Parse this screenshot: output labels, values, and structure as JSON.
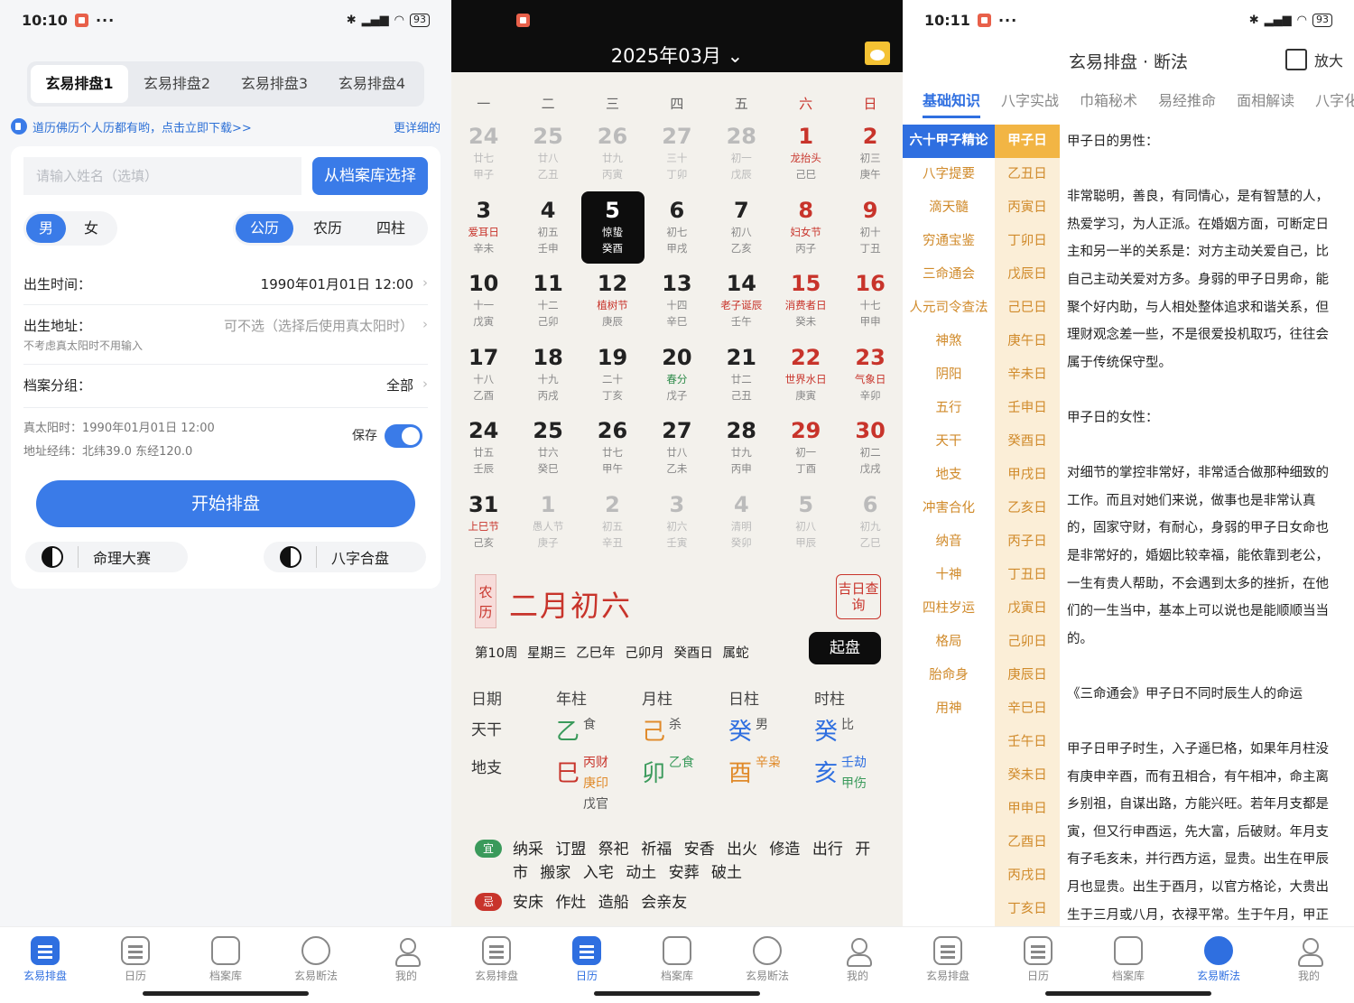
{
  "screen1": {
    "status": {
      "time": "10:10",
      "battery": "93"
    },
    "tabs": [
      "玄易排盘1",
      "玄易排盘2",
      "玄易排盘3",
      "玄易排盘4"
    ],
    "notice": {
      "text": "道历佛历个人历都有哟，点击立即下载>>",
      "more": "更详细的"
    },
    "name_placeholder": "请输入姓名（选填）",
    "archive_button": "从档案库选择",
    "gender": [
      "男",
      "女"
    ],
    "calendar_types": [
      "公历",
      "农历",
      "四柱"
    ],
    "birth_time": {
      "label": "出生时间：",
      "value": "1990年01月01日 12:00"
    },
    "birth_place": {
      "label": "出生地址：",
      "placeholder": "可不选（选择后使用真太阳时）",
      "hint": "不考虑真太阳时不用输入"
    },
    "group": {
      "label": "档案分组：",
      "value": "全部"
    },
    "solar_time": "真太阳时：1990年01月01日 12:00",
    "coords": "地址经纬：北纬39.0 东经120.0",
    "save_label": "保存",
    "start_button": "开始排盘",
    "contest_button": "命理大赛",
    "match_button": "八字合盘"
  },
  "nav": [
    "玄易排盘",
    "日历",
    "档案库",
    "玄易断法",
    "我的"
  ],
  "screen2": {
    "title": "2025年03月",
    "weekdays": [
      "一",
      "二",
      "三",
      "四",
      "五",
      "六",
      "日"
    ],
    "days": [
      {
        "d": "24",
        "l1": "廿七",
        "l2": "甲子",
        "t": "dim"
      },
      {
        "d": "25",
        "l1": "廿八",
        "l2": "乙丑",
        "t": "dim"
      },
      {
        "d": "26",
        "l1": "廿九",
        "l2": "丙寅",
        "t": "dim"
      },
      {
        "d": "27",
        "l1": "三十",
        "l2": "丁卯",
        "t": "dim"
      },
      {
        "d": "28",
        "l1": "初一",
        "l2": "戊辰",
        "t": "dim"
      },
      {
        "d": "1",
        "l1": "龙抬头",
        "l2": "己巳",
        "t": "red festred"
      },
      {
        "d": "2",
        "l1": "初三",
        "l2": "庚午",
        "t": "red"
      },
      {
        "d": "3",
        "l1": "爱耳日",
        "l2": "辛未",
        "t": "festred"
      },
      {
        "d": "4",
        "l1": "初五",
        "l2": "壬申",
        "t": ""
      },
      {
        "d": "5",
        "l1": "惊蛰",
        "l2": "癸酉",
        "t": "sel"
      },
      {
        "d": "6",
        "l1": "初七",
        "l2": "甲戌",
        "t": ""
      },
      {
        "d": "7",
        "l1": "初八",
        "l2": "乙亥",
        "t": ""
      },
      {
        "d": "8",
        "l1": "妇女节",
        "l2": "丙子",
        "t": "red festred"
      },
      {
        "d": "9",
        "l1": "初十",
        "l2": "丁丑",
        "t": "red"
      },
      {
        "d": "10",
        "l1": "十一",
        "l2": "戊寅",
        "t": ""
      },
      {
        "d": "11",
        "l1": "十二",
        "l2": "己卯",
        "t": ""
      },
      {
        "d": "12",
        "l1": "植树节",
        "l2": "庚辰",
        "t": "festred"
      },
      {
        "d": "13",
        "l1": "十四",
        "l2": "辛巳",
        "t": ""
      },
      {
        "d": "14",
        "l1": "老子诞辰",
        "l2": "壬午",
        "t": "festred"
      },
      {
        "d": "15",
        "l1": "消费者日",
        "l2": "癸未",
        "t": "red festred"
      },
      {
        "d": "16",
        "l1": "十七",
        "l2": "甲申",
        "t": "red"
      },
      {
        "d": "17",
        "l1": "十八",
        "l2": "乙酉",
        "t": ""
      },
      {
        "d": "18",
        "l1": "十九",
        "l2": "丙戌",
        "t": ""
      },
      {
        "d": "19",
        "l1": "二十",
        "l2": "丁亥",
        "t": ""
      },
      {
        "d": "20",
        "l1": "春分",
        "l2": "戊子",
        "t": "festgreen"
      },
      {
        "d": "21",
        "l1": "廿二",
        "l2": "己丑",
        "t": ""
      },
      {
        "d": "22",
        "l1": "世界水日",
        "l2": "庚寅",
        "t": "red festred"
      },
      {
        "d": "23",
        "l1": "气象日",
        "l2": "辛卯",
        "t": "red festred"
      },
      {
        "d": "24",
        "l1": "廿五",
        "l2": "壬辰",
        "t": ""
      },
      {
        "d": "25",
        "l1": "廿六",
        "l2": "癸巳",
        "t": ""
      },
      {
        "d": "26",
        "l1": "廿七",
        "l2": "甲午",
        "t": ""
      },
      {
        "d": "27",
        "l1": "廿八",
        "l2": "乙未",
        "t": ""
      },
      {
        "d": "28",
        "l1": "廿九",
        "l2": "丙申",
        "t": ""
      },
      {
        "d": "29",
        "l1": "初一",
        "l2": "丁酉",
        "t": "red"
      },
      {
        "d": "30",
        "l1": "初二",
        "l2": "戊戌",
        "t": "red"
      },
      {
        "d": "31",
        "l1": "上巳节",
        "l2": "己亥",
        "t": "festred"
      },
      {
        "d": "1",
        "l1": "愚人节",
        "l2": "庚子",
        "t": "dim"
      },
      {
        "d": "2",
        "l1": "初五",
        "l2": "辛丑",
        "t": "dim"
      },
      {
        "d": "3",
        "l1": "初六",
        "l2": "壬寅",
        "t": "dim"
      },
      {
        "d": "4",
        "l1": "清明",
        "l2": "癸卯",
        "t": "dim"
      },
      {
        "d": "5",
        "l1": "初八",
        "l2": "甲辰",
        "t": "dim"
      },
      {
        "d": "6",
        "l1": "初九",
        "l2": "乙巳",
        "t": "dim"
      }
    ],
    "nongli_label": "农历",
    "lunar_date": "二月初六",
    "jiri": "吉日查询",
    "meta": "第10周 星期三 乙巳年 己卯月 癸酉日 属蛇",
    "qipan": "起盘",
    "pillar_headers": [
      "日期",
      "年柱",
      "月柱",
      "日柱",
      "时柱"
    ],
    "tiangan_label": "天干",
    "dizhi_label": "地支",
    "tg": [
      {
        "g": "乙",
        "s": "食",
        "c": "c-green"
      },
      {
        "g": "己",
        "s": "杀",
        "c": "c-orange"
      },
      {
        "g": "癸",
        "s": "男",
        "c": "c-blue"
      },
      {
        "g": "癸",
        "s": "比",
        "c": "c-blue"
      }
    ],
    "dz": [
      {
        "g": "巳",
        "c": "c-red",
        "subs": [
          {
            "t": "丙财",
            "c": "c-red"
          },
          {
            "t": "庚印",
            "c": "c-orange"
          },
          {
            "t": "戊官",
            "c": "c-gray"
          }
        ]
      },
      {
        "g": "卯",
        "c": "c-green",
        "subs": [
          {
            "t": "乙食",
            "c": "c-green"
          }
        ]
      },
      {
        "g": "酉",
        "c": "c-orange",
        "subs": [
          {
            "t": "辛枭",
            "c": "c-orange"
          }
        ]
      },
      {
        "g": "亥",
        "c": "c-blue",
        "subs": [
          {
            "t": "壬劫",
            "c": "c-blue"
          },
          {
            "t": "甲伤",
            "c": "c-green"
          }
        ]
      }
    ],
    "yi_label": "宜",
    "yi_acts": "纳采 订盟 祭祀 祈福 安香 出火 修造 出行 开市 搬家 入宅 动土 安葬 破土",
    "ji_label": "忌",
    "ji_acts": "安床 作灶 造船 会亲友"
  },
  "screen3": {
    "status": {
      "time": "10:11",
      "battery": "93"
    },
    "title": "玄易排盘 · 断法",
    "zoom": "放大",
    "tabs": [
      "基础知识",
      "八字实战",
      "巾箱秘术",
      "易经推命",
      "面相解读",
      "八字化解"
    ],
    "categories": [
      "六十甲子精论",
      "八字提要",
      "滴天髓",
      "穷通宝鉴",
      "三命通会",
      "人元司令查法",
      "神煞",
      "阴阳",
      "五行",
      "天干",
      "地支",
      "冲害合化",
      "纳音",
      "十神",
      "四柱岁运",
      "格局",
      "胎命身",
      "用神"
    ],
    "days": [
      "甲子日",
      "乙丑日",
      "丙寅日",
      "丁卯日",
      "戊辰日",
      "己巳日",
      "庚午日",
      "辛未日",
      "壬申日",
      "癸酉日",
      "甲戌日",
      "乙亥日",
      "丙子日",
      "丁丑日",
      "戊寅日",
      "己卯日",
      "庚辰日",
      "辛巳日",
      "壬午日",
      "癸未日",
      "甲申日",
      "乙酉日",
      "丙戌日",
      "丁亥日"
    ],
    "article": [
      "甲子日的男性：",
      "",
      "非常聪明，善良，有同情心，是有智慧的人，热爱学习，为人正派。在婚姻方面，可断定日主和另一半的关系是：对方主动关爱自己，比自己主动关爱对方多。身弱的甲子日男命，能聚个好内助，与人相处整体追求和谐关系，但理财观念差一些，不是很爱投机取巧，往往会属于传统保守型。",
      "",
      "甲子日的女性：",
      "",
      "对细节的掌控非常好，非常适合做那种细致的工作。而且对她们来说，做事也是非常认真的，固家守财，有耐心，身弱的甲子日女命也是非常好的，婚姻比较幸福，能依靠到老公，一生有贵人帮助，不会遇到太多的挫折，在他们的一生当中，基本上可以说也是能顺顺当当的。",
      "",
      "《三命通会》甲子日不同时辰生人的命运",
      "",
      "甲子日甲子时生，入子遥巳格，如果年月柱没有庚申辛酉，而有丑相合，有午相冲，命主离乡别祖，自谋出路，方能兴旺。若年月支都是寅，但又行申酉运，先大富，后破财。年月支有子毛亥未，并行西方运，显贵。出生在甲辰月也显贵。出生于酉月，以官方格论，大贵出生于三月或八月，衣禄平常。生于午月，甲正"
    ]
  }
}
